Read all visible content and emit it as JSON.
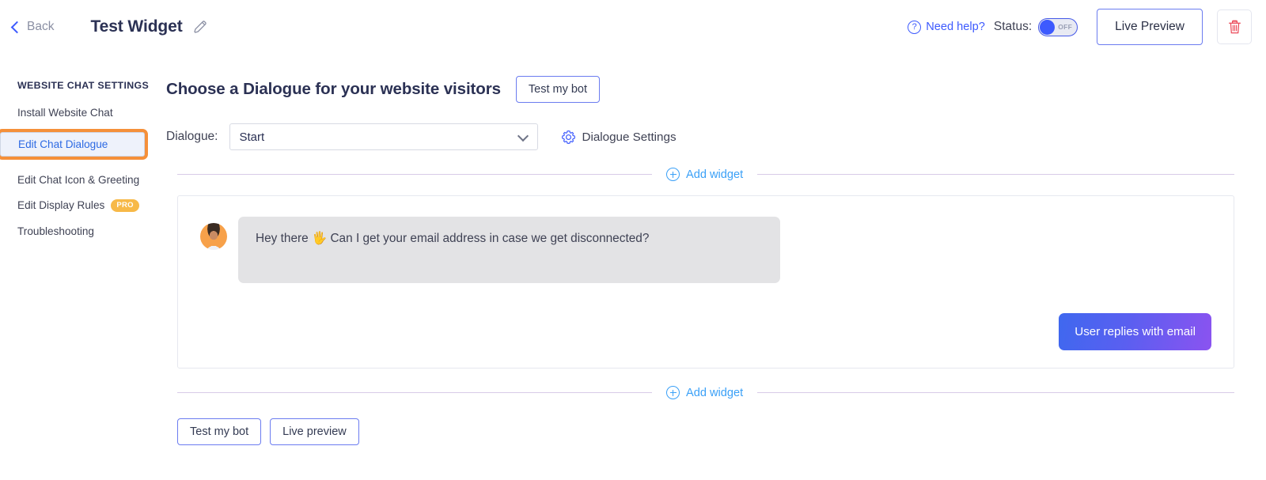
{
  "header": {
    "back_label": "Back",
    "widget_title": "Test Widget",
    "edit_title_icon": "pencil-icon",
    "need_help_label": "Need help?",
    "help_icon": "question-circle-icon",
    "status_label": "Status:",
    "status_toggle_value": "OFF",
    "live_preview_label": "Live Preview",
    "delete_icon": "trash-icon"
  },
  "sidebar": {
    "title": "WEBSITE CHAT SETTINGS",
    "items": [
      {
        "label": "Install Website Chat",
        "selected": false,
        "badge": null
      },
      {
        "label": "Edit Chat Dialogue",
        "selected": true,
        "badge": null
      },
      {
        "label": "Edit Chat Icon & Greeting",
        "selected": false,
        "badge": null
      },
      {
        "label": "Edit Display Rules",
        "selected": false,
        "badge": "PRO"
      },
      {
        "label": "Troubleshooting",
        "selected": false,
        "badge": null
      }
    ]
  },
  "main": {
    "title": "Choose a Dialogue for your website visitors",
    "test_my_bot_label": "Test my bot",
    "dialogue_label": "Dialogue:",
    "dialogue_value": "Start",
    "dialogue_options": [
      "Start"
    ],
    "dialogue_settings_label": "Dialogue Settings",
    "dialogue_settings_icon": "gear-icon",
    "add_widget_label": "Add widget",
    "add_widget_icon": "plus-circle-icon",
    "chat": {
      "bot_message": "Hey there 🖐 Can I get your email address in case we get disconnected?",
      "avatar_name": "agent-avatar",
      "user_reply_label": "User replies with email"
    },
    "footer_buttons": {
      "test_my_bot": "Test my bot",
      "live_preview": "Live preview"
    }
  },
  "colors": {
    "accent_blue": "#3d5afe",
    "link_blue": "#3aa0f7",
    "highlight_orange": "#f5903a",
    "pro_badge": "#f7b948",
    "danger_red": "#eb4b5a",
    "bot_bubble": "#e3e3e5",
    "user_bubble_start": "#3f68ef",
    "user_bubble_end": "#8b53f0"
  }
}
